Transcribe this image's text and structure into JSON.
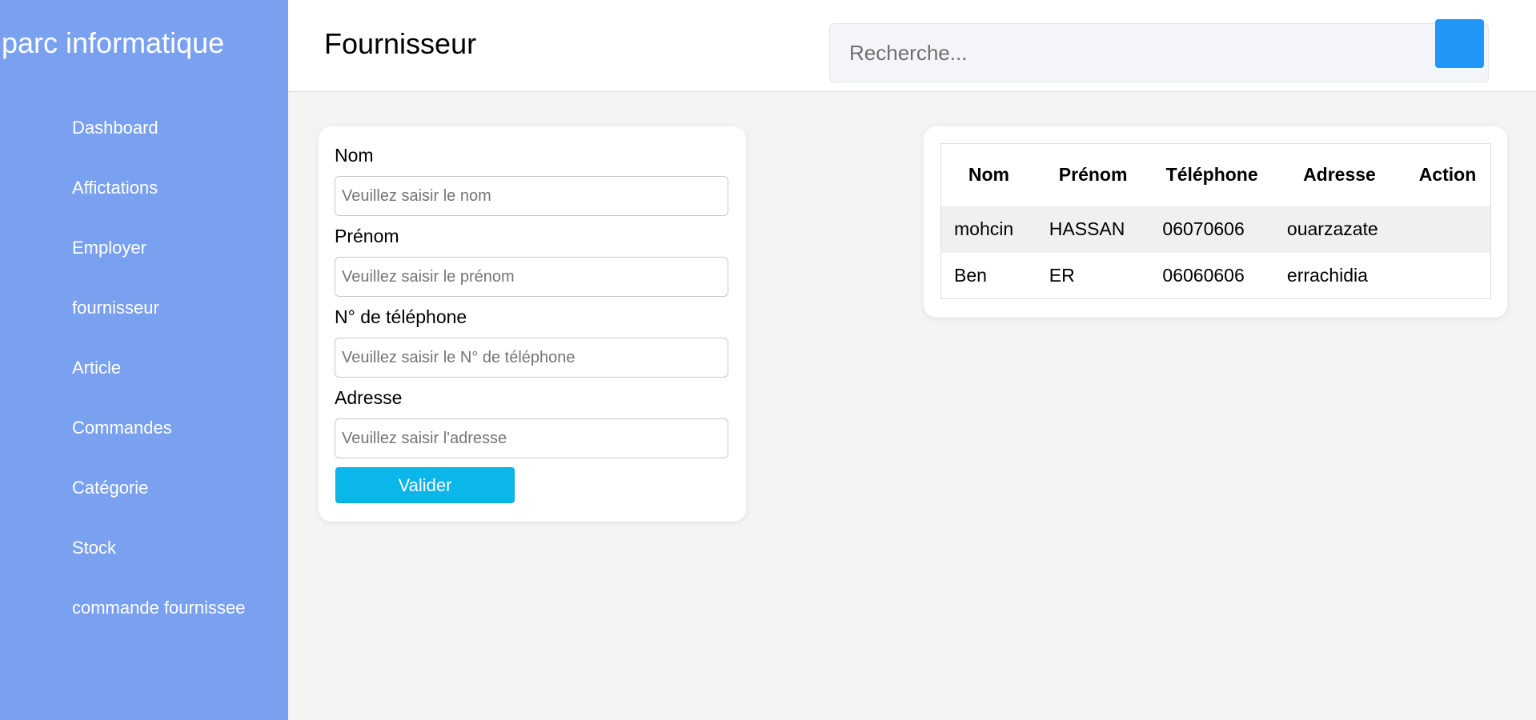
{
  "sidebar": {
    "brand": "parc informatique",
    "items": [
      {
        "label": "Dashboard"
      },
      {
        "label": "Affictations"
      },
      {
        "label": "Employer"
      },
      {
        "label": "fournisseur"
      },
      {
        "label": "Article"
      },
      {
        "label": "Commandes"
      },
      {
        "label": "Catégorie"
      },
      {
        "label": "Stock"
      },
      {
        "label": "commande fournissee"
      }
    ]
  },
  "header": {
    "title": "Fournisseur",
    "search_placeholder": "Recherche...",
    "search_button_color": "#2196f7"
  },
  "form": {
    "nom_label": "Nom",
    "nom_placeholder": "Veuillez saisir le nom",
    "prenom_label": "Prénom",
    "prenom_placeholder": "Veuillez saisir le prénom",
    "tel_label": "N° de téléphone",
    "tel_placeholder": "Veuillez saisir le N° de téléphone",
    "adresse_label": "Adresse",
    "adresse_placeholder": "Veuillez saisir l'adresse",
    "submit_label": "Valider"
  },
  "table": {
    "columns": [
      "Nom",
      "Prénom",
      "Téléphone",
      "Adresse",
      "Action"
    ],
    "rows": [
      {
        "nom": "mohcin",
        "prenom": "HASSAN",
        "telephone": "06070606",
        "adresse": "ouarzazate",
        "action": ""
      },
      {
        "nom": "Ben",
        "prenom": "ER",
        "telephone": "06060606",
        "adresse": "errachidia",
        "action": ""
      }
    ]
  },
  "colors": {
    "sidebar": "#7aa1ef",
    "accent": "#0bb6ea",
    "search_button": "#2196f7"
  }
}
